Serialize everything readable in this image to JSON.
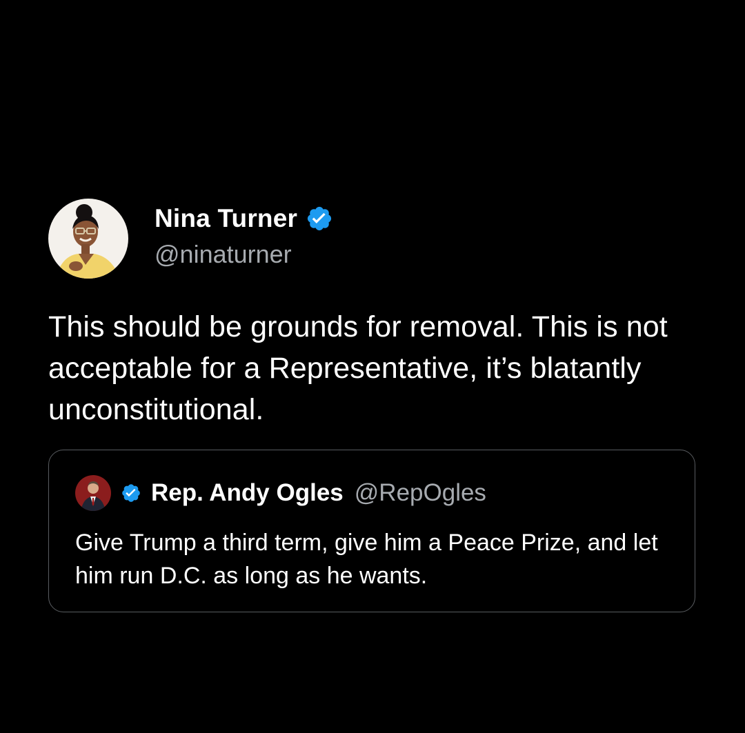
{
  "tweet": {
    "author": {
      "display_name": "Nina Turner",
      "handle": "@ninaturner",
      "verified": true,
      "avatar_icon": "profile-photo"
    },
    "text": "This should be grounds for removal. This is not acceptable for a Representative, it’s blatantly unconstitutional.",
    "quoted_tweet": {
      "author": {
        "display_name": "Rep. Andy Ogles",
        "handle": "@RepOgles",
        "verified": true,
        "avatar_icon": "profile-photo"
      },
      "text": "Give Trump a third term, give him a Peace Prize, and let him run D.C. as long as he wants."
    }
  },
  "colors": {
    "background": "#000000",
    "verified_blue": "#1d9bf0",
    "text_primary": "#ffffff",
    "text_secondary": "#a7abb0",
    "card_border": "#5a5d61"
  }
}
